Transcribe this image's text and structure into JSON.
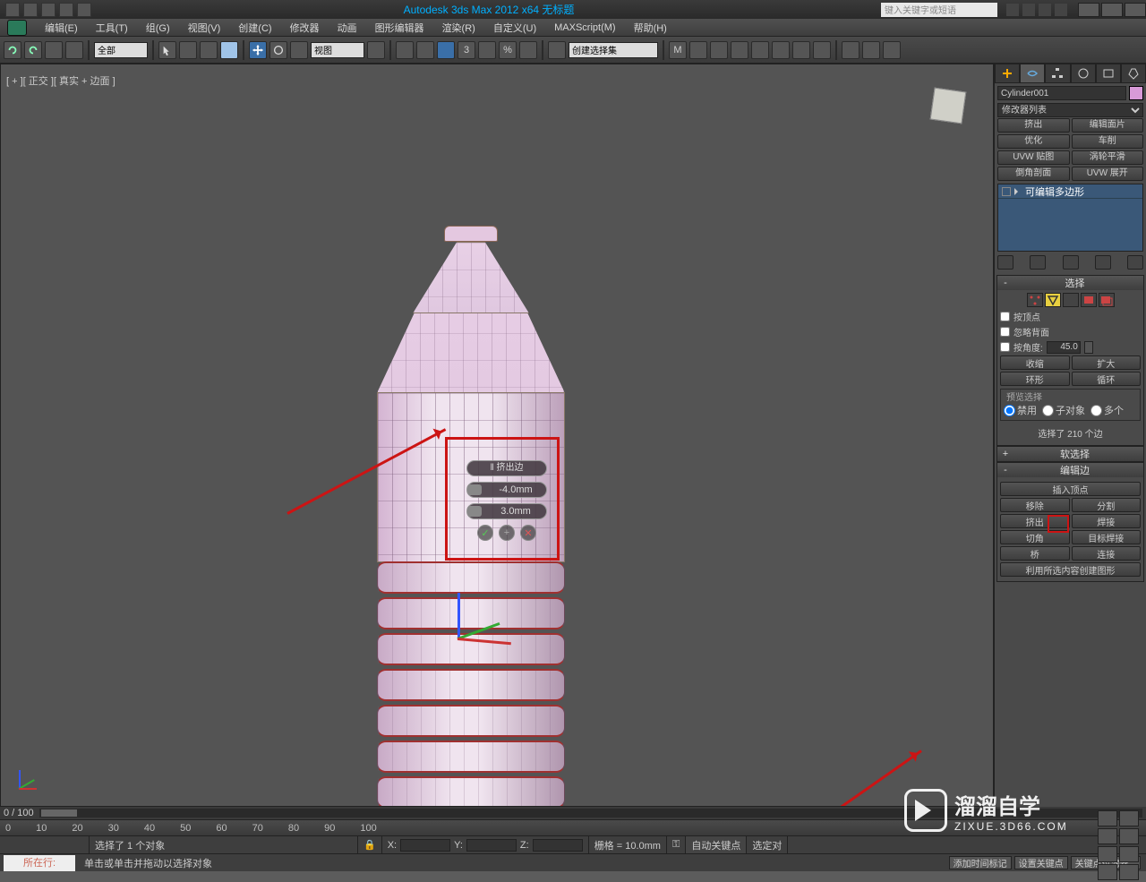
{
  "title": "Autodesk 3ds Max  2012 x64    无标题",
  "search_placeholder": "键入关键字或短语",
  "menus": [
    "编辑(E)",
    "工具(T)",
    "组(G)",
    "视图(V)",
    "创建(C)",
    "修改器",
    "动画",
    "图形编辑器",
    "渲染(R)",
    "自定义(U)",
    "MAXScript(M)",
    "帮助(H)"
  ],
  "toolbar": {
    "sel_filter": "全部",
    "view_dd": "视图",
    "named_set": "创建选择集"
  },
  "viewport_label": "[ + ][ 正交 ][ 真实 + 边面 ]",
  "caddy": {
    "title": "‖ 挤出边",
    "val1": "-4.0mm",
    "val2": "3.0mm"
  },
  "cmd": {
    "object": "Cylinder001",
    "mod_dd": "修改器列表",
    "preset_rows": [
      [
        "挤出",
        "编辑面片"
      ],
      [
        "优化",
        "车削"
      ],
      [
        "UVW 贴图",
        "涡轮平滑"
      ],
      [
        "倒角剖面",
        "UVW 展开"
      ]
    ],
    "stack_item": "可编辑多边形",
    "roll_select": {
      "title": "选择",
      "byvert": "按顶点",
      "ignback": "忽略背面",
      "byangle": "按角度:",
      "angle": "45.0",
      "shrink": "收缩",
      "grow": "扩大",
      "ring": "环形",
      "loop": "循环",
      "preview": "预览选择",
      "opt1": "禁用",
      "opt2": "子对象",
      "opt3": "多个",
      "count": "选择了 210 个边"
    },
    "roll_soft": "软选择",
    "roll_edit": {
      "title": "编辑边",
      "insert": "插入顶点",
      "remove": "移除",
      "split": "分割",
      "extrude": "挤出",
      "weld": "焊接",
      "chamfer": "切角",
      "tweld": "目标焊接",
      "bridge": "桥",
      "connect": "连接",
      "shape": "利用所选内容创建图形"
    }
  },
  "bottom": {
    "frames": "0 / 100",
    "status_sel": "选择了 1 个对象",
    "grid": "栅格 = 10.0mm",
    "autokey": "自动关键点",
    "selset": "选定对",
    "tip": "单击或单击并拖动以选择对象",
    "prompt_label": "所在行:",
    "add_time": "添加时间标记",
    "setkey": "设置关键点",
    "keyfilter": "关键点过滤器..."
  },
  "watermark": {
    "line1": "溜溜自学",
    "line2": "ZIXUE.3D66.COM"
  },
  "ticks": [
    "0",
    "10",
    "20",
    "30",
    "40",
    "50",
    "60",
    "70",
    "80",
    "90",
    "100"
  ]
}
